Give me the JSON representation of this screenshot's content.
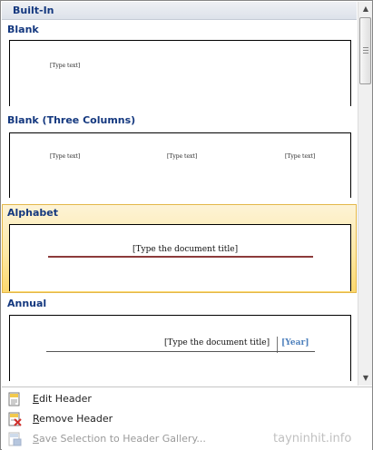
{
  "gallery": {
    "section_title": "Built-In",
    "items": [
      {
        "label": "Blank",
        "placeholders": [
          "[Type text]"
        ]
      },
      {
        "label": "Blank (Three Columns)",
        "placeholders": [
          "[Type text]",
          "[Type text]",
          "[Type text]"
        ]
      },
      {
        "label": "Alphabet",
        "title_placeholder": "[Type the document title]",
        "selected": true
      },
      {
        "label": "Annual",
        "title_placeholder": "[Type the document title]",
        "year_placeholder": "[Year]"
      }
    ]
  },
  "menu": {
    "edit_header": {
      "mnemonic": "E",
      "rest": "dit Header",
      "icon": "edit-header-icon"
    },
    "remove_header": {
      "mnemonic": "R",
      "rest": "emove Header",
      "icon": "remove-header-icon"
    },
    "save_selection": {
      "mnemonic": "S",
      "rest": "ave Selection to Header Gallery...",
      "icon": "save-selection-icon",
      "disabled": true
    }
  },
  "watermark": "tayninhit.info",
  "colors": {
    "label_blue": "#14387f",
    "selected_gold": "#fcd86d",
    "alphabet_rule": "#8c3b3b",
    "year_blue": "#4f81bd"
  }
}
